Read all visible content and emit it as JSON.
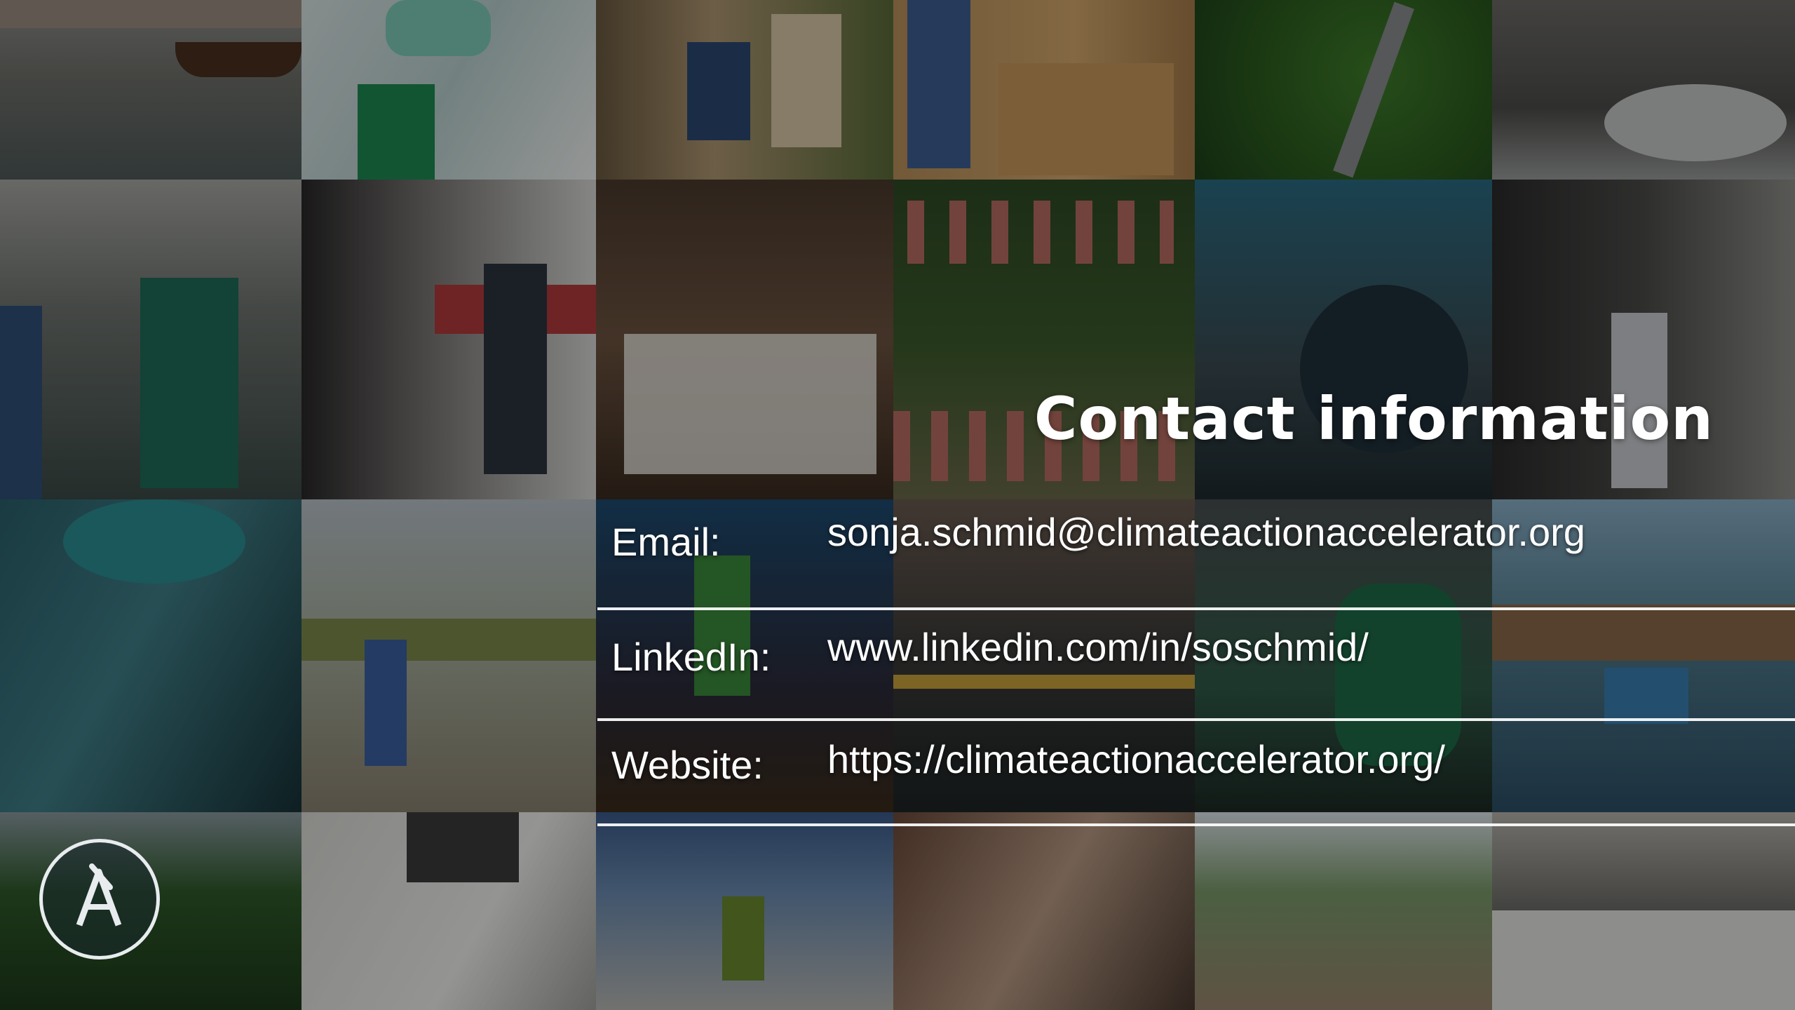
{
  "slide": {
    "title": "Contact information"
  },
  "contact": {
    "rows": [
      {
        "label": "Email:",
        "value": "sonja.schmid@climateactionaccelerator.org"
      },
      {
        "label": "LinkedIn:",
        "value": "www.linkedin.com/in/soschmid/"
      },
      {
        "label": "Website:",
        "value": "https://climateactionaccelerator.org/"
      }
    ]
  },
  "logo": {
    "icon": "climate-action-accelerator-logo-icon"
  },
  "colors": {
    "text": "#ffffff",
    "divider": "#ffffff",
    "overlay": "rgba(0,0,0,0.38)"
  },
  "photo_tiles": [
    "boats-flooded-village",
    "lab-pipette",
    "recycled-cardboard",
    "person-stacking-boxes",
    "aerial-road-forest",
    "flood-wave-street",
    "surgery-tent",
    "train-platform",
    "classroom-raised-hands",
    "aerial-flooded-houses",
    "plastic-waste-bins",
    "hospital-corridor",
    "surgeon-mask",
    "children-walking-water",
    "hands-holding-seedling",
    "cyclists-city-street",
    "nurse-at-desk",
    "stilt-houses-boat",
    "mangrove-trees",
    "laptop-planning",
    "solar-panel-workers",
    "child-drinking-water",
    "flooded-town-aerial",
    "bus-street"
  ]
}
